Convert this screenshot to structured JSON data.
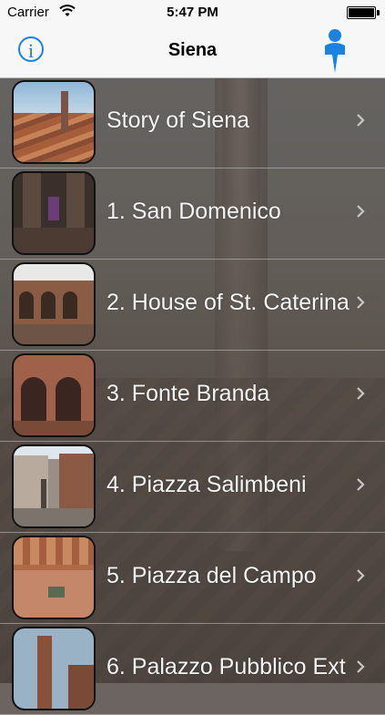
{
  "status_bar": {
    "carrier": "Carrier",
    "time": "5:47 PM"
  },
  "nav": {
    "title": "Siena",
    "info_label": "i",
    "left_icon": "info-icon",
    "right_icon": "map-pin-icon",
    "accent_color": "#1a82e2"
  },
  "list": {
    "items": [
      {
        "label": "Story of Siena",
        "icon": "chevron-right-icon"
      },
      {
        "label": "1. San Domenico",
        "icon": "chevron-right-icon"
      },
      {
        "label": "2. House of St. Caterina",
        "icon": "chevron-right-icon"
      },
      {
        "label": "3. Fonte Branda",
        "icon": "chevron-right-icon"
      },
      {
        "label": "4. Piazza Salimbeni",
        "icon": "chevron-right-icon"
      },
      {
        "label": "5. Piazza del Campo",
        "icon": "chevron-right-icon"
      },
      {
        "label": "6. Palazzo Pubblico Ext",
        "icon": "chevron-right-icon"
      }
    ]
  }
}
